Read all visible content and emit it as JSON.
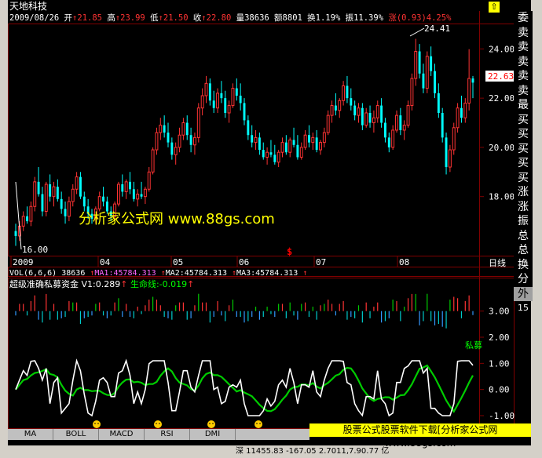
{
  "stock": {
    "name": "天地科技",
    "date": "2009/08/26",
    "open_label": "开",
    "open": "21.85",
    "high_label": "高",
    "high": "23.99",
    "low_label": "低",
    "low": "21.50",
    "close_label": "收",
    "close": "22.80",
    "volume_label": "量",
    "volume": "38636",
    "amount_label": "额",
    "amount": "8801",
    "turnover_label": "换",
    "turnover": "1.19%",
    "amplitude_label": "振",
    "amplitude": "11.39%",
    "change_label": "涨",
    "change": "(0.93)4.25%"
  },
  "price_chart": {
    "y_ticks": [
      "24.00",
      "22.00",
      "20.00",
      "18.00"
    ],
    "current_price": "22.63",
    "max_label": "24.41",
    "min_label": "16.00",
    "watermark": "分析家公式网  www.88gs.com",
    "marker": "$"
  },
  "time_axis": {
    "labels": [
      "2009",
      "04",
      "05",
      "06",
      "07",
      "08"
    ],
    "period": "日线"
  },
  "volume_line": {
    "vol_label": "VOL(6,6,6)",
    "vol_value": "38636",
    "ma1": "MA1:45784.313",
    "ma2": "MA2:45784.313",
    "ma3": "MA3:45784.313"
  },
  "indicator": {
    "title": "超级准确私募资金",
    "v1": "V1:0.289",
    "life_line": "生命线:-0.019",
    "y_ticks": [
      "3.00",
      "2.00",
      "1.00",
      "0.00",
      "-1.00"
    ],
    "private_label": "私募"
  },
  "side_panel": {
    "labels": [
      "委",
      "卖",
      "卖",
      "卖",
      "卖",
      "卖",
      "最",
      "买",
      "买",
      "买",
      "买",
      "买",
      "涨",
      "涨",
      "振",
      "总",
      "总",
      "换",
      "分",
      "外"
    ],
    "highlight_index": 19,
    "extra": "15"
  },
  "tabs": [
    "MA",
    "BOLL",
    "MACD",
    "RSI",
    "DMI"
  ],
  "footer": {
    "watermark_bar": "股票公式股票软件下载[分析家公式网www.88gs.com",
    "status": "深  11455.83 -167.05  2.7011,7.90.77 亿"
  },
  "colors": {
    "up": "#ff3333",
    "down": "#00ffff",
    "grid": "#800000",
    "ma_green": "#00cc00",
    "white": "#ffffff",
    "yellow": "#ffff00"
  },
  "chart_data": {
    "type": "candlestick",
    "ylim": [
      15.6,
      25.0
    ],
    "candles": [
      [
        16.6,
        16.9,
        16.0,
        16.4
      ],
      [
        16.4,
        17.0,
        16.2,
        16.8
      ],
      [
        16.8,
        17.4,
        16.6,
        17.2
      ],
      [
        17.2,
        17.6,
        16.9,
        17.0
      ],
      [
        17.0,
        17.8,
        16.8,
        17.6
      ],
      [
        17.6,
        18.8,
        17.4,
        18.6
      ],
      [
        18.6,
        19.2,
        18.0,
        18.1
      ],
      [
        18.1,
        18.4,
        17.2,
        17.4
      ],
      [
        17.4,
        18.6,
        17.2,
        18.5
      ],
      [
        18.5,
        18.9,
        17.8,
        18.0
      ],
      [
        18.0,
        18.6,
        17.6,
        18.4
      ],
      [
        18.4,
        18.7,
        17.8,
        17.9
      ],
      [
        17.9,
        18.2,
        17.3,
        17.5
      ],
      [
        17.5,
        17.8,
        16.9,
        17.2
      ],
      [
        17.2,
        18.0,
        17.0,
        17.8
      ],
      [
        17.8,
        18.5,
        17.6,
        18.3
      ],
      [
        18.3,
        19.0,
        18.1,
        18.8
      ],
      [
        18.8,
        19.0,
        17.9,
        18.0
      ],
      [
        18.0,
        18.2,
        17.4,
        17.6
      ],
      [
        17.6,
        17.9,
        17.1,
        17.3
      ],
      [
        17.3,
        17.5,
        16.9,
        17.1
      ],
      [
        17.1,
        17.6,
        16.9,
        17.5
      ],
      [
        17.5,
        18.2,
        17.4,
        18.0
      ],
      [
        18.0,
        18.4,
        17.6,
        17.8
      ],
      [
        17.8,
        18.0,
        17.3,
        17.4
      ],
      [
        17.4,
        17.6,
        17.0,
        17.2
      ],
      [
        17.2,
        17.8,
        17.1,
        17.7
      ],
      [
        17.7,
        18.6,
        17.6,
        18.5
      ],
      [
        18.5,
        18.9,
        18.0,
        18.2
      ],
      [
        18.2,
        18.7,
        17.9,
        18.6
      ],
      [
        18.6,
        19.0,
        18.1,
        18.3
      ],
      [
        18.3,
        18.6,
        17.8,
        17.9
      ],
      [
        17.9,
        18.3,
        17.6,
        18.1
      ],
      [
        18.1,
        18.6,
        17.9,
        18.0
      ],
      [
        18.0,
        18.4,
        17.7,
        18.3
      ],
      [
        18.3,
        19.2,
        18.2,
        19.0
      ],
      [
        19.0,
        20.0,
        18.9,
        19.9
      ],
      [
        19.9,
        20.8,
        19.7,
        20.6
      ],
      [
        20.6,
        21.2,
        20.3,
        20.9
      ],
      [
        20.9,
        21.3,
        20.4,
        20.6
      ],
      [
        20.6,
        21.0,
        20.0,
        20.2
      ],
      [
        20.2,
        20.4,
        19.5,
        19.7
      ],
      [
        19.7,
        20.2,
        19.3,
        20.0
      ],
      [
        20.0,
        20.8,
        19.8,
        20.5
      ],
      [
        20.5,
        21.2,
        20.3,
        21.0
      ],
      [
        21.0,
        21.3,
        20.3,
        20.5
      ],
      [
        20.5,
        20.8,
        19.8,
        20.1
      ],
      [
        20.1,
        20.6,
        19.7,
        20.4
      ],
      [
        20.4,
        21.8,
        20.2,
        21.6
      ],
      [
        21.6,
        22.4,
        21.3,
        22.1
      ],
      [
        22.1,
        22.9,
        21.8,
        22.6
      ],
      [
        22.6,
        22.8,
        21.7,
        21.9
      ],
      [
        21.9,
        22.3,
        21.4,
        21.6
      ],
      [
        21.6,
        22.4,
        21.4,
        22.2
      ],
      [
        22.2,
        22.7,
        21.8,
        22.0
      ],
      [
        22.0,
        22.3,
        21.2,
        21.4
      ],
      [
        21.4,
        21.9,
        21.0,
        21.7
      ],
      [
        21.7,
        22.6,
        21.6,
        22.4
      ],
      [
        22.4,
        22.8,
        21.9,
        22.1
      ],
      [
        22.1,
        22.6,
        21.5,
        21.8
      ],
      [
        21.8,
        22.0,
        20.9,
        21.1
      ],
      [
        21.1,
        21.3,
        20.3,
        20.5
      ],
      [
        20.5,
        20.9,
        20.0,
        20.2
      ],
      [
        20.2,
        20.7,
        19.9,
        20.4
      ],
      [
        20.4,
        20.6,
        19.7,
        19.9
      ],
      [
        19.9,
        20.2,
        19.5,
        19.6
      ],
      [
        19.6,
        20.0,
        19.3,
        19.8
      ],
      [
        19.8,
        20.3,
        19.6,
        19.7
      ],
      [
        19.7,
        20.1,
        19.3,
        19.4
      ],
      [
        19.4,
        19.9,
        19.2,
        19.8
      ],
      [
        19.8,
        20.4,
        19.6,
        20.2
      ],
      [
        20.2,
        20.5,
        19.7,
        19.8
      ],
      [
        19.8,
        20.4,
        19.6,
        20.3
      ],
      [
        20.3,
        20.8,
        20.0,
        20.1
      ],
      [
        20.1,
        20.5,
        19.5,
        19.6
      ],
      [
        19.6,
        20.2,
        19.5,
        20.0
      ],
      [
        20.0,
        20.7,
        19.9,
        20.5
      ],
      [
        20.5,
        20.9,
        20.0,
        20.2
      ],
      [
        20.2,
        20.6,
        19.9,
        20.4
      ],
      [
        20.4,
        20.7,
        19.8,
        19.9
      ],
      [
        19.9,
        20.3,
        19.7,
        20.2
      ],
      [
        20.2,
        20.8,
        20.0,
        20.6
      ],
      [
        20.6,
        21.5,
        20.5,
        21.3
      ],
      [
        21.3,
        21.9,
        21.0,
        21.7
      ],
      [
        21.7,
        22.2,
        21.3,
        21.5
      ],
      [
        21.5,
        22.0,
        21.2,
        21.9
      ],
      [
        21.9,
        22.7,
        21.7,
        22.5
      ],
      [
        22.5,
        22.9,
        21.8,
        22.0
      ],
      [
        22.0,
        22.4,
        21.5,
        21.7
      ],
      [
        21.7,
        21.9,
        21.1,
        21.3
      ],
      [
        21.3,
        21.8,
        21.0,
        21.6
      ],
      [
        21.6,
        21.8,
        20.7,
        20.9
      ],
      [
        20.9,
        21.6,
        20.8,
        21.4
      ],
      [
        21.4,
        21.7,
        20.8,
        21.0
      ],
      [
        21.0,
        21.5,
        20.6,
        21.2
      ],
      [
        21.2,
        21.9,
        21.0,
        21.7
      ],
      [
        21.7,
        22.0,
        20.8,
        21.0
      ],
      [
        21.0,
        21.2,
        20.2,
        20.4
      ],
      [
        20.4,
        20.6,
        19.8,
        20.0
      ],
      [
        20.0,
        20.9,
        19.9,
        20.7
      ],
      [
        20.7,
        21.5,
        20.6,
        21.3
      ],
      [
        21.3,
        21.6,
        20.5,
        20.7
      ],
      [
        20.7,
        21.1,
        20.3,
        20.9
      ],
      [
        20.9,
        21.9,
        20.8,
        21.7
      ],
      [
        21.7,
        23.0,
        21.5,
        22.8
      ],
      [
        22.8,
        24.41,
        22.5,
        23.9
      ],
      [
        23.9,
        24.2,
        22.8,
        23.0
      ],
      [
        23.0,
        23.4,
        22.2,
        22.4
      ],
      [
        22.4,
        23.9,
        22.2,
        23.7
      ],
      [
        23.7,
        24.1,
        22.9,
        23.1
      ],
      [
        23.1,
        23.4,
        22.0,
        22.2
      ],
      [
        22.2,
        22.6,
        21.2,
        21.4
      ],
      [
        21.4,
        21.6,
        20.2,
        20.4
      ],
      [
        20.4,
        20.6,
        18.9,
        19.2
      ],
      [
        19.2,
        20.1,
        19.0,
        19.9
      ],
      [
        19.9,
        21.0,
        19.7,
        20.8
      ],
      [
        20.8,
        21.8,
        20.6,
        21.6
      ],
      [
        21.6,
        22.1,
        21.0,
        21.2
      ],
      [
        21.2,
        22.0,
        21.0,
        21.8
      ],
      [
        21.8,
        23.99,
        21.5,
        22.8
      ],
      [
        22.8,
        22.9,
        22.0,
        22.63
      ]
    ],
    "indicator_lines": {
      "V1": "white",
      "life_line": "green"
    }
  }
}
